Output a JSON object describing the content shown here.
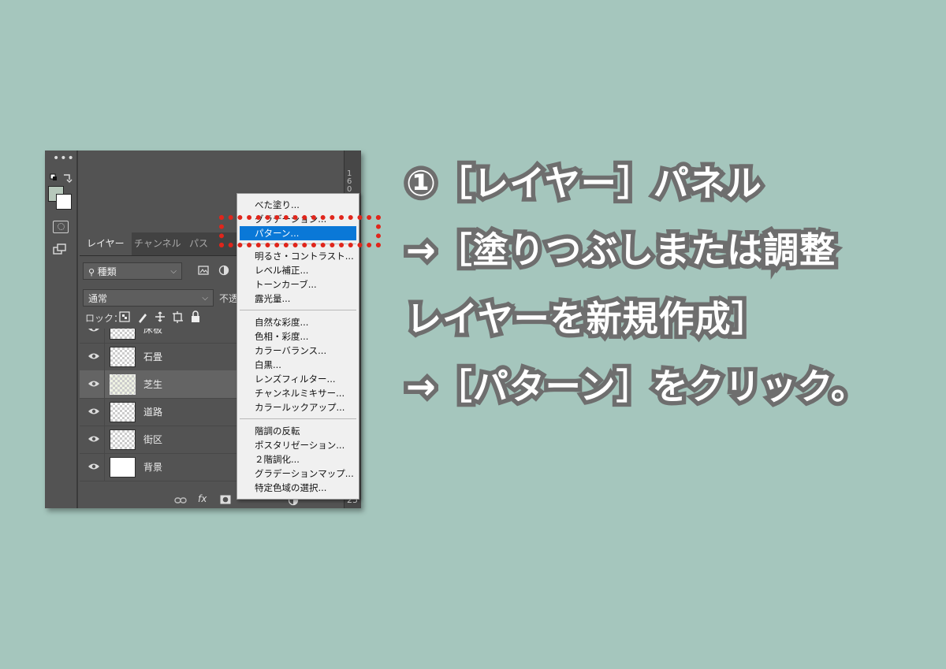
{
  "colors": {
    "background": "#a5c6bd",
    "panel": "#535353",
    "menu_highlight": "#0a78d7",
    "callout_dots": "#e0251b",
    "caption_stroke": "#6e6e6e"
  },
  "toolbar": {
    "more_label": "•••",
    "icons": [
      "swap-colors-icon",
      "foreground-color-swatch",
      "background-color-swatch",
      "quick-mask-icon",
      "screen-mode-icon"
    ]
  },
  "ruler": {
    "digits": "1\n6\n0",
    "bottom_value": "25"
  },
  "layers_panel": {
    "tabs": [
      "レイヤー",
      "チャンネル",
      "パス"
    ],
    "filter_select": "種類",
    "blend_mode": "通常",
    "opacity_label": "不透",
    "lock_label": "ロック：",
    "layers": [
      {
        "name": "床板",
        "thumb": "checker",
        "selected": false
      },
      {
        "name": "石畳",
        "thumb": "checker",
        "selected": false
      },
      {
        "name": "芝生",
        "thumb": "grass",
        "selected": true
      },
      {
        "name": "道路",
        "thumb": "checker",
        "selected": false
      },
      {
        "name": "街区",
        "thumb": "checker",
        "selected": false
      },
      {
        "name": "背景",
        "thumb": "white",
        "selected": false
      }
    ],
    "bottom_fx": "fx"
  },
  "menu": {
    "items": [
      "べた塗り...",
      "グラデーション...",
      "パターン...",
      "明るさ・コントラスト...",
      "レベル補正...",
      "トーンカーブ...",
      "露光量...",
      "自然な彩度...",
      "色相・彩度...",
      "カラーバランス...",
      "白黒...",
      "レンズフィルター...",
      "チャンネルミキサー...",
      "カラールックアップ...",
      "階調の反転",
      "ポスタリゼーション...",
      "２階調化...",
      "グラデーションマップ...",
      "特定色域の選択..."
    ],
    "highlighted": "パターン..."
  },
  "caption": {
    "line1": "①［レイヤー］パネル",
    "line2": "→［塗りつぶしまたは調整",
    "line3": "レイヤーを新規作成］",
    "line4": "→［パターン］をクリック。"
  }
}
